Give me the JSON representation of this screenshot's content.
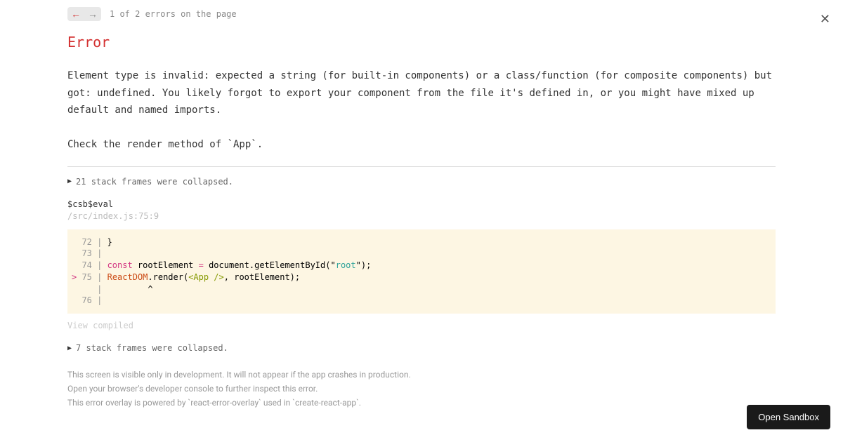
{
  "navigation": {
    "error_position": "1 of 2 errors on the page"
  },
  "error": {
    "title": "Error",
    "message": "Element type is invalid: expected a string (for built-in components) or a class/function (for composite components) but got: undefined. You likely forgot to export your component from the file it's defined in, or you might have mixed up default and named imports.\n\nCheck the render method of `App`."
  },
  "stack": {
    "collapsed_top": "21 stack frames were collapsed.",
    "frame_name": "$csb$eval",
    "frame_location": "/src/index.js:75:9",
    "collapsed_bottom": "7 stack frames were collapsed.",
    "view_compiled": "View compiled"
  },
  "code": {
    "line72_num": "  72 | ",
    "line72_text": "}",
    "line73_num": "  73 | ",
    "line74_num": "  74 | ",
    "line74_const": "const",
    "line74_mid": " rootElement ",
    "line74_eq": "=",
    "line74_doc": " document.getElementById(",
    "line74_quote1": "\"",
    "line74_root": "root",
    "line74_quote2": "\"",
    "line74_end": ");",
    "line75_marker": ">",
    "line75_num": " 75 | ",
    "line75_react": "ReactDOM",
    "line75_render": ".render(",
    "line75_jsx": "<App />",
    "line75_end": ", rootElement);",
    "line_caret_num": "     | ",
    "line_caret": "        ^",
    "line76_num": "  76 | "
  },
  "footer": {
    "line1": "This screen is visible only in development. It will not appear if the app crashes in production.",
    "line2": "Open your browser's developer console to further inspect this error.",
    "line3": "This error overlay is powered by `react-error-overlay` used in `create-react-app`."
  },
  "sandbox_button": "Open Sandbox"
}
